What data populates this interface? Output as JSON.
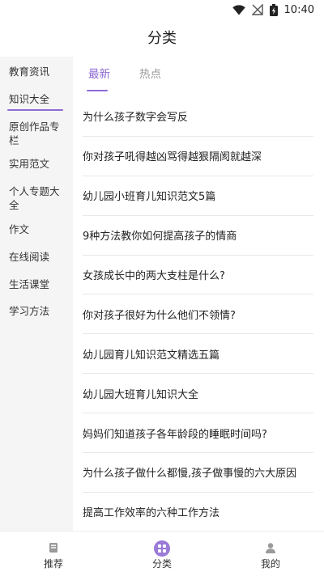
{
  "status_bar": {
    "time": "10:40"
  },
  "header": {
    "title": "分类"
  },
  "sidebar": {
    "items": [
      {
        "label": "教育资讯"
      },
      {
        "label": "知识大全",
        "active": true
      },
      {
        "label": "原创作品专栏"
      },
      {
        "label": "实用范文"
      },
      {
        "label": "个人专题大全"
      },
      {
        "label": "作文"
      },
      {
        "label": "在线阅读"
      },
      {
        "label": "生活课堂"
      },
      {
        "label": "学习方法"
      }
    ]
  },
  "tabs": [
    {
      "label": "最新",
      "active": true
    },
    {
      "label": "热点",
      "active": false
    }
  ],
  "articles": [
    "为什么孩子数字会写反",
    "你对孩子吼得越凶骂得越狠隔阂就越深",
    "幼儿园小班育儿知识范文5篇",
    "9种方法教你如何提高孩子的情商",
    "女孩成长中的两大支柱是什么?",
    "你对孩子很好为什么他们不领情?",
    "幼儿园育儿知识范文精选五篇",
    "幼儿园大班育儿知识大全",
    "妈妈们知道孩子各年龄段的睡眠时间吗?",
    "为什么孩子做什么都慢,孩子做事慢的六大原因",
    "提高工作效率的六种工作方法"
  ],
  "bottom_nav": [
    {
      "label": "推荐",
      "icon": "book-icon"
    },
    {
      "label": "分类",
      "icon": "category-grid-icon",
      "active": true
    },
    {
      "label": "我的",
      "icon": "person-icon"
    }
  ],
  "colors": {
    "accent": "#8e6bd6",
    "sidebar_bg": "#f5f5f5"
  }
}
